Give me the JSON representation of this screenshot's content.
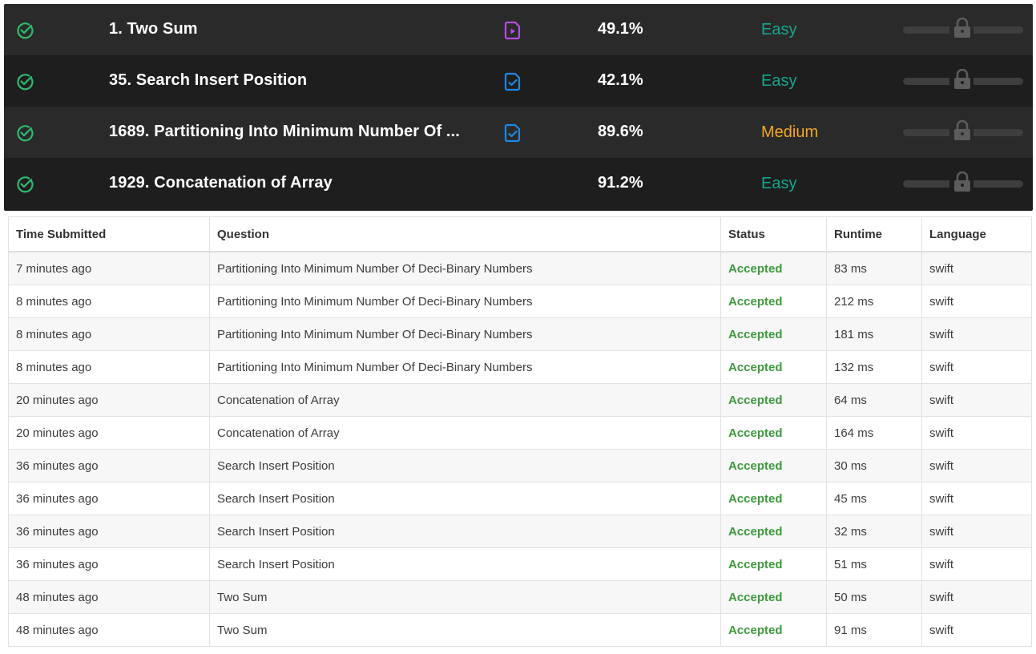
{
  "colors": {
    "easy": "#14a891",
    "medium": "#f5a623",
    "check": "#2dbd6e",
    "solution_video": "#b44fe3",
    "solution_article": "#1e88e5",
    "accepted": "#3c9a3c"
  },
  "problems": [
    {
      "title": "1. Two Sum",
      "solution_icon": "video-solution-icon",
      "acceptance": "49.1%",
      "difficulty": "Easy"
    },
    {
      "title": "35. Search Insert Position",
      "solution_icon": "article-solution-icon",
      "acceptance": "42.1%",
      "difficulty": "Easy"
    },
    {
      "title": "1689. Partitioning Into Minimum Number Of ...",
      "solution_icon": "article-solution-icon",
      "acceptance": "89.6%",
      "difficulty": "Medium"
    },
    {
      "title": "1929. Concatenation of Array",
      "solution_icon": "",
      "acceptance": "91.2%",
      "difficulty": "Easy"
    }
  ],
  "submissions": {
    "headers": {
      "time": "Time Submitted",
      "question": "Question",
      "status": "Status",
      "runtime": "Runtime",
      "language": "Language"
    },
    "rows": [
      {
        "time": "7 minutes ago",
        "question": "Partitioning Into Minimum Number Of Deci-Binary Numbers",
        "status": "Accepted",
        "runtime": "83 ms",
        "language": "swift"
      },
      {
        "time": "8 minutes ago",
        "question": "Partitioning Into Minimum Number Of Deci-Binary Numbers",
        "status": "Accepted",
        "runtime": "212 ms",
        "language": "swift"
      },
      {
        "time": "8 minutes ago",
        "question": "Partitioning Into Minimum Number Of Deci-Binary Numbers",
        "status": "Accepted",
        "runtime": "181 ms",
        "language": "swift"
      },
      {
        "time": "8 minutes ago",
        "question": "Partitioning Into Minimum Number Of Deci-Binary Numbers",
        "status": "Accepted",
        "runtime": "132 ms",
        "language": "swift"
      },
      {
        "time": "20 minutes ago",
        "question": "Concatenation of Array",
        "status": "Accepted",
        "runtime": "64 ms",
        "language": "swift"
      },
      {
        "time": "20 minutes ago",
        "question": "Concatenation of Array",
        "status": "Accepted",
        "runtime": "164 ms",
        "language": "swift"
      },
      {
        "time": "36 minutes ago",
        "question": "Search Insert Position",
        "status": "Accepted",
        "runtime": "30 ms",
        "language": "swift"
      },
      {
        "time": "36 minutes ago",
        "question": "Search Insert Position",
        "status": "Accepted",
        "runtime": "45 ms",
        "language": "swift"
      },
      {
        "time": "36 minutes ago",
        "question": "Search Insert Position",
        "status": "Accepted",
        "runtime": "32 ms",
        "language": "swift"
      },
      {
        "time": "36 minutes ago",
        "question": "Search Insert Position",
        "status": "Accepted",
        "runtime": "51 ms",
        "language": "swift"
      },
      {
        "time": "48 minutes ago",
        "question": "Two Sum",
        "status": "Accepted",
        "runtime": "50 ms",
        "language": "swift"
      },
      {
        "time": "48 minutes ago",
        "question": "Two Sum",
        "status": "Accepted",
        "runtime": "91 ms",
        "language": "swift"
      }
    ]
  }
}
